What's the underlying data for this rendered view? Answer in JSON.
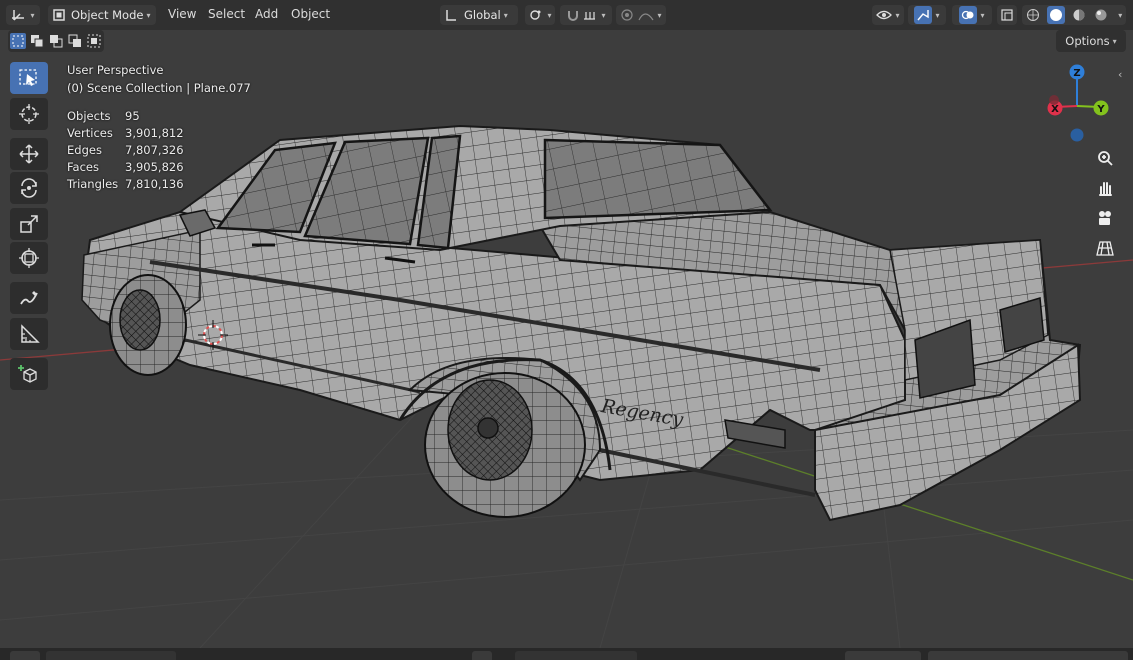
{
  "header": {
    "mode_label": "Object Mode",
    "menus": [
      "View",
      "Select",
      "Add",
      "Object"
    ],
    "transform_orientation": "Global",
    "options_label": "Options"
  },
  "viewport": {
    "perspective_label": "User Perspective",
    "collection_label": "(0) Scene Collection | Plane.077",
    "stats": [
      {
        "label": "Objects",
        "value": "95"
      },
      {
        "label": "Vertices",
        "value": "3,901,812"
      },
      {
        "label": "Edges",
        "value": "7,807,326"
      },
      {
        "label": "Faces",
        "value": "3,905,826"
      },
      {
        "label": "Triangles",
        "value": "7,810,136"
      }
    ],
    "emblem_text": "Regency"
  },
  "gizmo": {
    "z": "Z",
    "x": "X",
    "y": "Y",
    "colors": {
      "z": "#2f7fd9",
      "x": "#e0314b",
      "y": "#83c21d"
    }
  },
  "toolbar": {
    "tools": [
      "select-box-icon",
      "cursor-icon",
      "move-icon",
      "rotate-icon",
      "scale-icon",
      "transform-icon",
      "annotate-icon",
      "measure-icon",
      "add-cube-icon"
    ]
  },
  "colors": {
    "accent": "#4772b3",
    "header": "#303030",
    "viewport": "#3d3d3d"
  }
}
